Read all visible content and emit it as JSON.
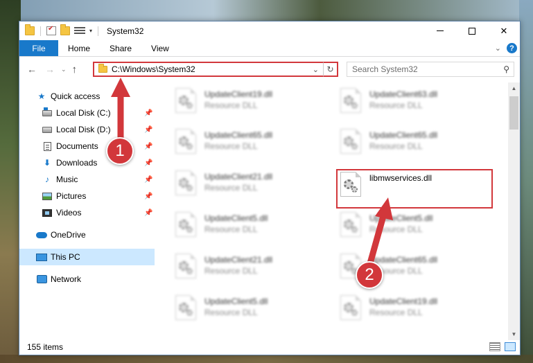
{
  "window": {
    "title": "System32"
  },
  "ribbon": {
    "tabs": [
      "File",
      "Home",
      "Share",
      "View"
    ]
  },
  "address": {
    "path": "C:\\Windows\\System32",
    "search_placeholder": "Search System32"
  },
  "nav": {
    "quick_access": "Quick access",
    "items": [
      {
        "label": "Local Disk (C:)",
        "icon": "local-disk-icon"
      },
      {
        "label": "Local Disk (D:)",
        "icon": "local-disk-icon"
      },
      {
        "label": "Documents",
        "icon": "documents-icon"
      },
      {
        "label": "Downloads",
        "icon": "downloads-icon"
      },
      {
        "label": "Music",
        "icon": "music-icon"
      },
      {
        "label": "Pictures",
        "icon": "pictures-icon"
      },
      {
        "label": "Videos",
        "icon": "videos-icon"
      }
    ],
    "onedrive": "OneDrive",
    "this_pc": "This PC",
    "network": "Network"
  },
  "files": {
    "left": [
      {
        "name": "UpdateClient19.dll",
        "type": "Resource DLL"
      },
      {
        "name": "UpdateClient65.dll",
        "type": "Resource DLL"
      },
      {
        "name": "UpdateClient21.dll",
        "type": "Resource DLL"
      },
      {
        "name": "UpdateClient5.dll",
        "type": "Resource DLL"
      },
      {
        "name": "UpdateClient21.dll",
        "type": "Resource DLL"
      },
      {
        "name": "UpdateClient5.dll",
        "type": "Resource DLL"
      }
    ],
    "right": [
      {
        "name": "UpdateClient63.dll",
        "type": "Resource DLL"
      },
      {
        "name": "UpdateClient65.dll",
        "type": "Resource DLL"
      },
      {
        "name": "libmwservices.dll",
        "type": ""
      },
      {
        "name": "UpdateClient5.dll",
        "type": "Resource DLL"
      },
      {
        "name": "UpdateClient65.dll",
        "type": "Resource DLL"
      },
      {
        "name": "UpdateClient19.dll",
        "type": "Resource DLL"
      }
    ]
  },
  "status": {
    "items_count": "155 items"
  },
  "annotations": {
    "step1": "1",
    "step2": "2"
  },
  "colors": {
    "accent": "#1979ca",
    "highlight_red": "#d2373b",
    "selected_bg": "#cce8ff"
  }
}
